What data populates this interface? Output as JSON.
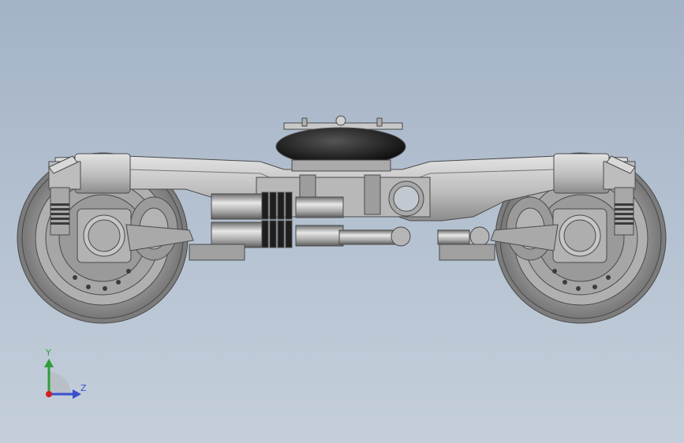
{
  "viewport": {
    "background_top": "#a3b3c6",
    "background_bottom": "#c5cfdb",
    "part_fill": "#c4c4c4",
    "part_shadow": "#8f8f8f",
    "edge_color": "#4a4a4a",
    "rubber_color": "#1c1c1c"
  },
  "triad": {
    "y_label": "Y",
    "z_label": "Z",
    "y_color": "#2f9e3a",
    "z_color": "#3a4fd0",
    "x_color": "#d02020"
  }
}
